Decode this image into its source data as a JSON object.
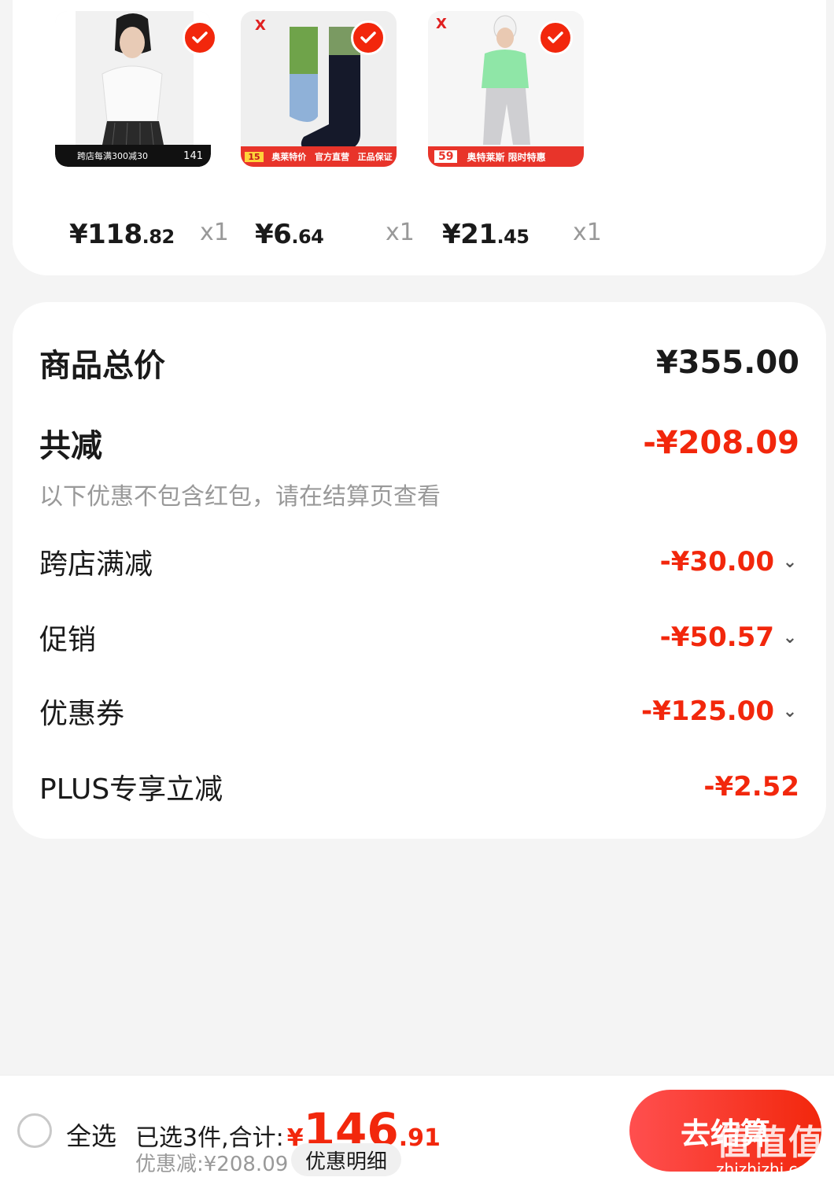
{
  "products": [
    {
      "price_int": "¥118",
      "price_dec": ".82",
      "qty": "x1",
      "banner": "跨店每满300减30",
      "banner_num": "141"
    },
    {
      "price_int": "¥6",
      "price_dec": ".64",
      "qty": "x1",
      "banner_tag": "15",
      "banner_a": "奥莱特价",
      "banner_b": "官方直营",
      "banner_c": "正品保证"
    },
    {
      "price_int": "¥21",
      "price_dec": ".45",
      "qty": "x1",
      "banner_tag": "59",
      "banner": "奥特莱斯 限时特惠"
    }
  ],
  "summary": {
    "total_label": "商品总价",
    "total_value": "¥355.00",
    "reduce_label": "共减",
    "reduce_value": "-¥208.09",
    "note": "以下优惠不包含红包，请在结算页查看",
    "items": [
      {
        "label": "跨店满减",
        "value": "-¥30.00",
        "expandable": true
      },
      {
        "label": "促销",
        "value": "-¥50.57",
        "expandable": true
      },
      {
        "label": "优惠券",
        "value": "-¥125.00",
        "expandable": true
      },
      {
        "label": "PLUS专享立减",
        "value": "-¥2.52",
        "expandable": false
      }
    ]
  },
  "bottom": {
    "select_all": "全选",
    "selected_prefix": "已选3件,合计:",
    "yen": "¥",
    "total_int": "146",
    "total_dec": ".91",
    "discount": "优惠减:¥208.09",
    "detail_button": "优惠明细",
    "checkout_button": "去结算"
  },
  "watermark": {
    "text": "值值值",
    "url": "zhizhizhi.com"
  },
  "colors": {
    "accent": "#f2270c",
    "muted": "#999999",
    "background": "#f4f4f4"
  }
}
